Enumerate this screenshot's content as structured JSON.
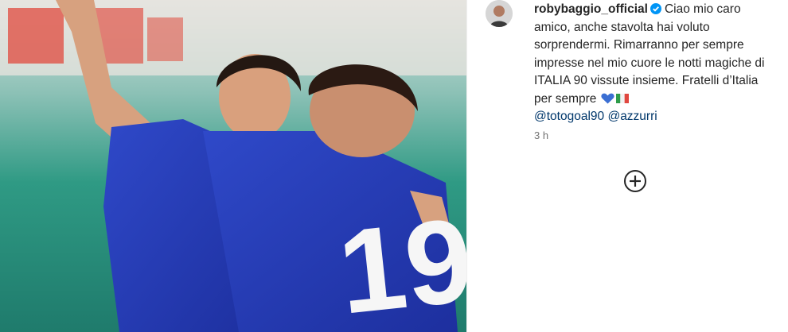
{
  "post": {
    "username": "robybaggio_official",
    "caption_text": "Ciao mio caro amico, anche stavolta hai voluto sorprendermi. Rimarranno per sempre impresse nel mio cuore le notti magiche di ITALIA 90 vissute insieme. Fratelli d’Italia per sempre",
    "mentions": [
      "@totogoal90",
      "@azzurri"
    ],
    "timestamp": "3 h",
    "jersey_number": "19"
  },
  "icons": {
    "verified": "verified-badge-icon",
    "heart": "blue-heart-emoji",
    "flag": "italy-flag-emoji",
    "add": "add-circle-icon"
  },
  "colors": {
    "verified_blue": "#0095f6",
    "mention_blue": "#00376b",
    "text": "#262626",
    "muted": "#737373"
  }
}
